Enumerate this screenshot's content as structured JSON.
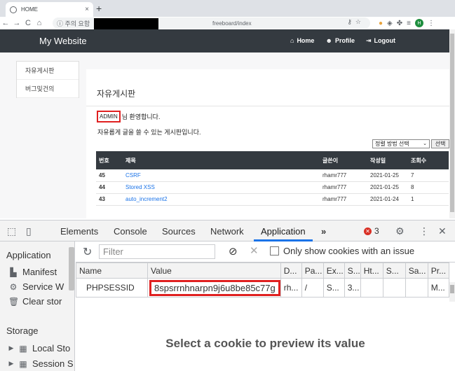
{
  "browser": {
    "tab_title": "HOME",
    "tab_close": "×",
    "new_tab": "+",
    "nav_back": "←",
    "nav_forward": "→",
    "nav_reload": "C",
    "nav_home": "⌂",
    "security_label": "ⓘ 주의 요함",
    "url_path": "freeboard/index",
    "avatar_letter": "H"
  },
  "site": {
    "brand": "My Website",
    "nav": [
      {
        "icon": "⌂",
        "label": "Home"
      },
      {
        "icon": "☻",
        "label": "Profile"
      },
      {
        "icon": "⇥",
        "label": "Logout"
      }
    ],
    "sidebar": [
      "자유게시판",
      "버그및건의"
    ],
    "board_title": "자유게시판",
    "admin_name": "ADMIN",
    "welcome_suffix": "님 환영합니다.",
    "description": "자유롭게 글을 쓸 수 있는 게시판입니다.",
    "sort_select": "정렬 방법 선택",
    "sort_button": "선택",
    "table_headers": [
      "번호",
      "제목",
      "글쓴이",
      "작성일",
      "조회수"
    ],
    "rows": [
      {
        "no": "45",
        "title": "CSRF",
        "author": "rhamr777",
        "date": "2021-01-25",
        "views": "7"
      },
      {
        "no": "44",
        "title": "Stored XSS",
        "author": "rhamr777",
        "date": "2021-01-25",
        "views": "8"
      },
      {
        "no": "43",
        "title": "auto_increment2",
        "author": "rhamr777",
        "date": "2021-01-24",
        "views": "1"
      }
    ]
  },
  "devtools": {
    "tabs": [
      "Elements",
      "Console",
      "Sources",
      "Network",
      "Application"
    ],
    "active_tab": "Application",
    "more_tabs": "»",
    "error_count": "3",
    "sidebar": {
      "application_head": "Application",
      "application_items": [
        "Manifest",
        "Service W",
        "Clear stor"
      ],
      "storage_head": "Storage",
      "storage_items": [
        "Local Sto",
        "Session S"
      ]
    },
    "filter_placeholder": "Filter",
    "only_issue_label": "Only show cookies with an issue",
    "columns": [
      "Name",
      "Value",
      "D...",
      "Pa...",
      "Ex...",
      "S...",
      "Ht...",
      "S...",
      "Sa...",
      "Pr..."
    ],
    "cookie": {
      "name": "PHPSESSID",
      "value": "8spsrrnhnarpn9j6u8be85c77g",
      "domain": "rh...",
      "path": "/",
      "expires": "S...",
      "size": "3...",
      "http": "",
      "secure": "",
      "samesite": "",
      "priority": "M..."
    },
    "preview_text": "Select a cookie to preview its value"
  }
}
